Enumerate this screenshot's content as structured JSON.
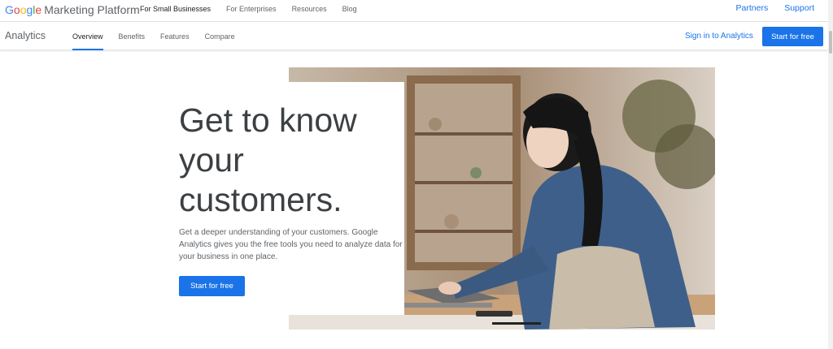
{
  "brand": {
    "google_letters": [
      {
        "ch": "G",
        "color": "#4285F4"
      },
      {
        "ch": "o",
        "color": "#EA4335"
      },
      {
        "ch": "o",
        "color": "#FBBC05"
      },
      {
        "ch": "g",
        "color": "#4285F4"
      },
      {
        "ch": "l",
        "color": "#34A853"
      },
      {
        "ch": "e",
        "color": "#EA4335"
      }
    ],
    "rest": "Marketing Platform"
  },
  "topnav": [
    {
      "label": "For Small Businesses",
      "active": true
    },
    {
      "label": "For Enterprises",
      "active": false
    },
    {
      "label": "Resources",
      "active": false
    },
    {
      "label": "Blog",
      "active": false
    }
  ],
  "toplinks": {
    "partners": "Partners",
    "support": "Support"
  },
  "subnav": {
    "product": "Analytics",
    "tabs": [
      {
        "label": "Overview",
        "active": true
      },
      {
        "label": "Benefits",
        "active": false
      },
      {
        "label": "Features",
        "active": false
      },
      {
        "label": "Compare",
        "active": false
      }
    ],
    "signin": "Sign in to Analytics",
    "cta": "Start for free"
  },
  "hero": {
    "headline_lines": [
      "Get to know",
      "your",
      "customers."
    ],
    "description": "Get a deeper understanding of your customers. Google Analytics gives you the free tools you need to analyze data for your business in one place.",
    "cta": "Start for free"
  },
  "colors": {
    "accent": "#1a73e8",
    "text": "#3c4043",
    "muted": "#5f6368"
  }
}
